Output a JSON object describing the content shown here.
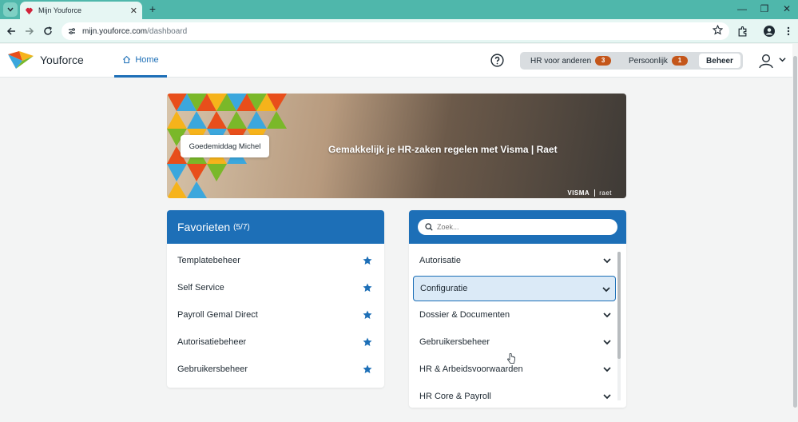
{
  "browser": {
    "tab_title": "Mijn Youforce",
    "tab_close": "✕",
    "new_tab": "+",
    "url_host": "mijn.youforce.com",
    "url_path": "/dashboard",
    "window_controls": [
      "—",
      "❐",
      "✕"
    ]
  },
  "header": {
    "brand": "Youforce",
    "home_label": "Home",
    "segments": [
      {
        "label": "HR voor anderen",
        "badge": "3"
      },
      {
        "label": "Persoonlijk",
        "badge": "1"
      }
    ],
    "active_segment": "Beheer"
  },
  "banner": {
    "greeting": "Goedemiddag Michel",
    "headline": "Gemakkelijk je HR-zaken regelen met Visma | Raet",
    "brand_mark": "VISMA",
    "brand_sub": "raet"
  },
  "favorites": {
    "title": "Favorieten",
    "count": "(5/7)",
    "items": [
      "Templatebeheer",
      "Self Service",
      "Payroll Gemal Direct",
      "Autorisatiebeheer",
      "Gebruikersbeheer"
    ]
  },
  "menu": {
    "search_placeholder": "Zoek...",
    "items": [
      "Autorisatie",
      "Configuratie",
      "Dossier & Documenten",
      "Gebruikersbeheer",
      "HR & Arbeidsvoorwaarden",
      "HR Core & Payroll"
    ],
    "selected": "Configuratie"
  },
  "colors": {
    "primary": "#1d6fb7",
    "badge": "#c4561a",
    "chrome": "#4fb7ab"
  },
  "icons": [
    "home-icon",
    "help-icon",
    "user-icon",
    "star-icon",
    "chevron-down-icon",
    "search-icon"
  ]
}
